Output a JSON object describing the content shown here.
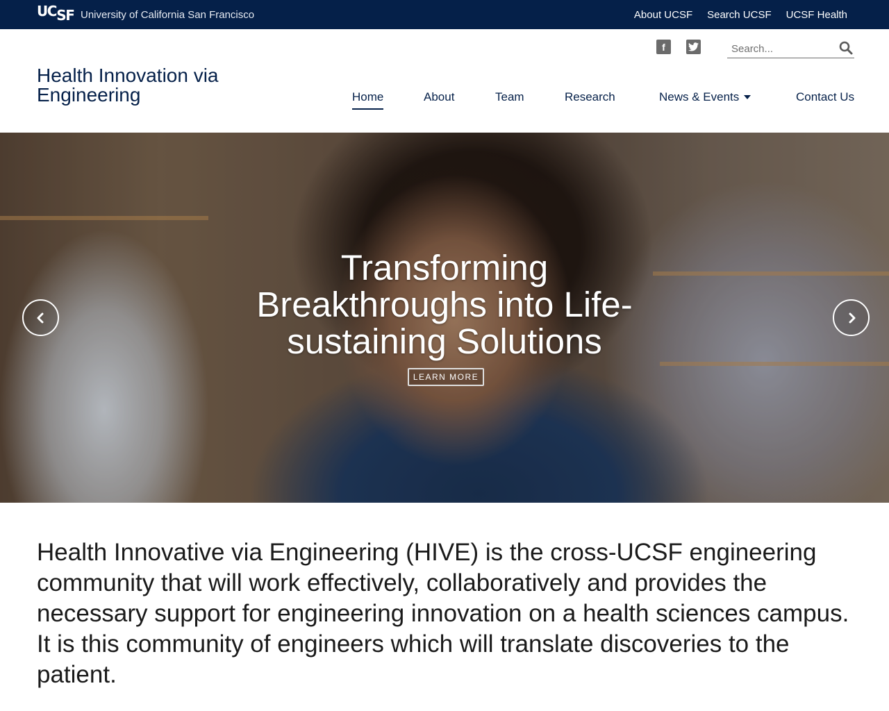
{
  "topbar": {
    "logo": "UCSF",
    "university": "University of California San Francisco",
    "links": [
      "About UCSF",
      "Search UCSF",
      "UCSF Health"
    ]
  },
  "header": {
    "site_title": "Health Innovation via Engineering",
    "search_placeholder": "Search...",
    "social": {
      "facebook": "f",
      "twitter": "t"
    }
  },
  "nav": {
    "items": [
      "Home",
      "About",
      "Team",
      "Research",
      "News & Events",
      "Contact Us"
    ],
    "active": "Home"
  },
  "hero": {
    "heading": "Transforming Breakthroughs into Life-sustaining Solutions",
    "button": "LEARN MORE"
  },
  "intro": {
    "text": "Health Innovative via Engineering (HIVE) is the cross-UCSF engineering community that will work effectively, collaboratively and provides the necessary support for engineering innovation on a health sciences campus. It is this community of engineers which will translate discoveries to the patient."
  },
  "colors": {
    "navy": "#052049",
    "text": "#1a1a1a",
    "white": "#ffffff"
  }
}
